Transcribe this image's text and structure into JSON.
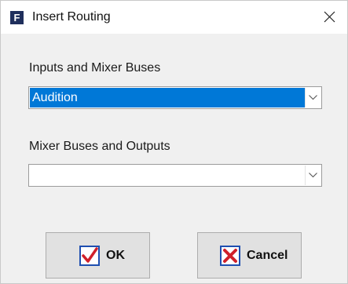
{
  "window": {
    "title": "Insert Routing",
    "app_icon_letter": "F",
    "close_glyph": "×"
  },
  "fields": {
    "inputs_label": "Inputs and Mixer Buses",
    "inputs_value": "Audition",
    "outputs_label": "Mixer Buses and Outputs",
    "outputs_value": ""
  },
  "buttons": {
    "ok_label": "OK",
    "cancel_label": "Cancel"
  },
  "icons": {
    "app": "app-logo-icon",
    "close": "close-icon",
    "dropdown": "chevron-down-icon",
    "ok": "checkmark-icon",
    "cancel": "x-mark-icon"
  },
  "colors": {
    "selection": "#0078d7",
    "ok_check": "#d0202a",
    "ok_box": "#1f4fb0",
    "cancel_x": "#d0202a",
    "cancel_box": "#1f4fb0",
    "app_icon_bg": "#1f2f5c"
  }
}
